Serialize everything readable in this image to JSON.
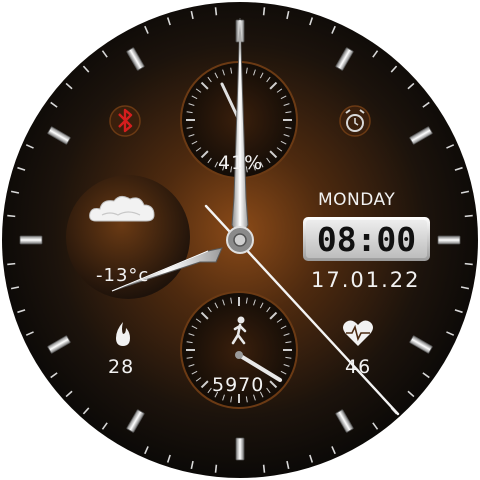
{
  "watch_face": {
    "day": "MONDAY",
    "time": "08:00",
    "date": "17.01.22",
    "battery": "41%",
    "temperature": "-13°c",
    "flame_value": "28",
    "heart_rate": "46",
    "steps": "5970",
    "battery_level": 0.41
  },
  "icons": {
    "bluetooth": "bluetooth-icon",
    "alarm": "alarm-clock-icon",
    "weather": "cloud-icon",
    "flame": "flame-icon",
    "heart": "heart-pulse-icon",
    "steps": "walking-person-icon"
  },
  "colors": {
    "dial_center": "#7a3f12",
    "dial_edge": "#0c0a08",
    "bluetooth_red": "#d41e1e",
    "text": "#f2f2f2"
  }
}
